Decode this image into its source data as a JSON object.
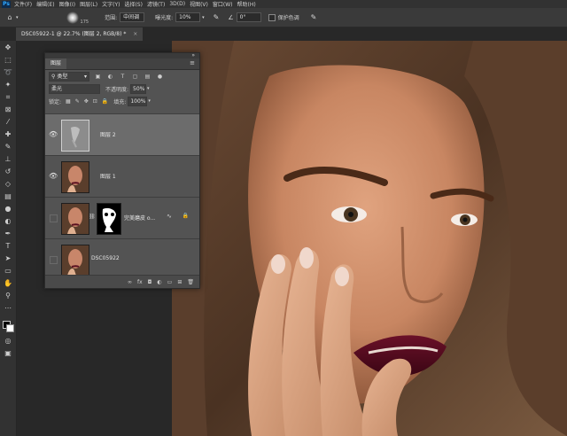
{
  "menubar": {
    "app_logo": "Ps",
    "items": [
      "文件(F)",
      "编辑(E)",
      "图像(I)",
      "图层(L)",
      "文字(Y)",
      "选择(S)",
      "滤镜(T)",
      "3D(D)",
      "视图(V)",
      "窗口(W)",
      "帮助(H)"
    ]
  },
  "options_bar": {
    "brush_size": "175",
    "range_label": "范围:",
    "range_value": "中间调",
    "exposure_label": "曝光度:",
    "exposure_value": "10%",
    "angle_value": "0°",
    "protect_tones_label": "保护色调"
  },
  "document_tab": {
    "title": "DSC05922-1 @ 22.7% (图层 2, RGB/8) *",
    "close": "×"
  },
  "layers_panel": {
    "tab_label": "图层",
    "kind_filter": "类型",
    "blend_mode": "柔光",
    "opacity_label": "不透明度:",
    "opacity_value": "50%",
    "lock_label": "锁定:",
    "fill_label": "填充:",
    "fill_value": "100%",
    "layers": [
      {
        "name": "图层 2",
        "visible": true,
        "selected": true
      },
      {
        "name": "图层 1",
        "visible": true,
        "selected": false
      },
      {
        "name": "完美磨皮 o...",
        "visible": false,
        "selected": false,
        "smart_filter": true,
        "locked": true
      },
      {
        "name": "DSC05922",
        "visible": false,
        "selected": false
      }
    ],
    "footer_icons": [
      "link-icon",
      "fx-icon",
      "mask-icon",
      "adjustment-icon",
      "group-icon",
      "new-layer-icon",
      "trash-icon"
    ]
  },
  "colors": {
    "app_background": "#282828",
    "panel_background": "#535353",
    "selected_layer": "#6c6c6c",
    "accent": "#31a8ff"
  }
}
